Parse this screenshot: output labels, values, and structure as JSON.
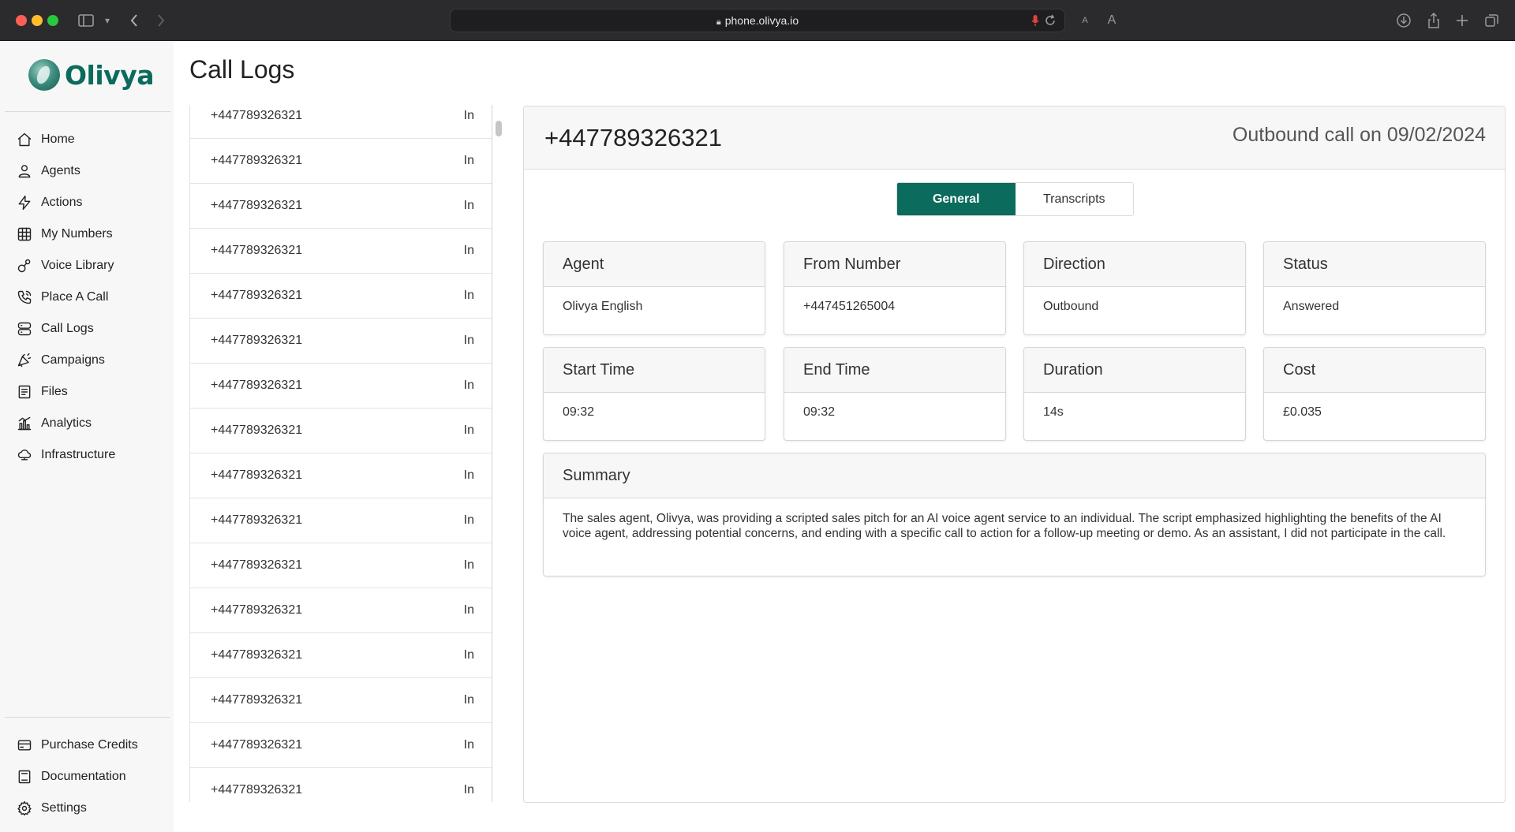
{
  "browser": {
    "url": "phone.olivya.io"
  },
  "brand": {
    "name": "Olivya",
    "accent": "#0b6b5c"
  },
  "sidebar": {
    "items": [
      {
        "label": "Home",
        "icon": "home-icon"
      },
      {
        "label": "Agents",
        "icon": "user-icon"
      },
      {
        "label": "Actions",
        "icon": "lightning-icon"
      },
      {
        "label": "My Numbers",
        "icon": "keypad-icon"
      },
      {
        "label": "Voice Library",
        "icon": "voice-library-icon"
      },
      {
        "label": "Place A Call",
        "icon": "phone-call-icon"
      },
      {
        "label": "Call Logs",
        "icon": "server-icon"
      },
      {
        "label": "Campaigns",
        "icon": "megaphone-icon"
      },
      {
        "label": "Files",
        "icon": "document-icon"
      },
      {
        "label": "Analytics",
        "icon": "analytics-icon"
      },
      {
        "label": "Infrastructure",
        "icon": "cloud-icon"
      }
    ],
    "bottom_items": [
      {
        "label": "Purchase Credits",
        "icon": "credit-card-icon"
      },
      {
        "label": "Documentation",
        "icon": "book-icon"
      },
      {
        "label": "Settings",
        "icon": "gear-icon"
      }
    ]
  },
  "page": {
    "title": "Call Logs"
  },
  "call_list": {
    "rows": [
      {
        "number": "+447789326321",
        "direction": "In"
      },
      {
        "number": "+447789326321",
        "direction": "In"
      },
      {
        "number": "+447789326321",
        "direction": "In"
      },
      {
        "number": "+447789326321",
        "direction": "In"
      },
      {
        "number": "+447789326321",
        "direction": "In"
      },
      {
        "number": "+447789326321",
        "direction": "In"
      },
      {
        "number": "+447789326321",
        "direction": "In"
      },
      {
        "number": "+447789326321",
        "direction": "In"
      },
      {
        "number": "+447789326321",
        "direction": "In"
      },
      {
        "number": "+447789326321",
        "direction": "In"
      },
      {
        "number": "+447789326321",
        "direction": "In"
      },
      {
        "number": "+447789326321",
        "direction": "In"
      },
      {
        "number": "+447789326321",
        "direction": "In"
      },
      {
        "number": "+447789326321",
        "direction": "In"
      },
      {
        "number": "+447789326321",
        "direction": "In"
      },
      {
        "number": "+447789326321",
        "direction": "In"
      }
    ]
  },
  "detail": {
    "number": "+447789326321",
    "meta": "Outbound call on 09/02/2024",
    "tabs": {
      "general": "General",
      "transcripts": "Transcripts"
    },
    "fields": [
      {
        "label": "Agent",
        "value": "Olivya English"
      },
      {
        "label": "From Number",
        "value": "+447451265004"
      },
      {
        "label": "Direction",
        "value": "Outbound"
      },
      {
        "label": "Status",
        "value": "Answered"
      },
      {
        "label": "Start Time",
        "value": "09:32"
      },
      {
        "label": "End Time",
        "value": "09:32"
      },
      {
        "label": "Duration",
        "value": "14s"
      },
      {
        "label": "Cost",
        "value": "£0.035"
      }
    ],
    "summary": {
      "label": "Summary",
      "text": "The sales agent, Olivya, was providing a scripted sales pitch for an AI voice agent service to an individual. The script emphasized highlighting the benefits of the AI voice agent, addressing potential concerns, and ending with a specific call to action for a follow-up meeting or demo. As an assistant, I did not participate in the call."
    }
  }
}
